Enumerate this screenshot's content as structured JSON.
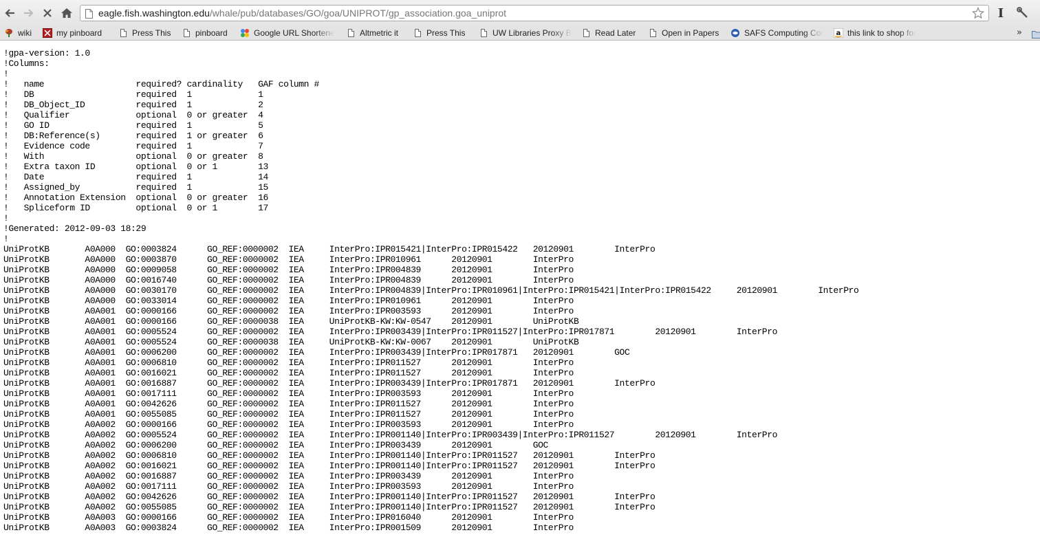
{
  "browser": {
    "url_host": "eagle.fish.washington.edu",
    "url_path": "/whale/pub/databases/GO/goa/UNIPROT/gp_association.goa_uniprot",
    "bookmarks": [
      {
        "label": "wiki",
        "icon": "plant-icon"
      },
      {
        "label": "my pinboard",
        "icon": "pinboard-icon"
      },
      {
        "label": "Press This",
        "icon": "doc-icon"
      },
      {
        "label": "pinboard",
        "icon": "doc-icon"
      },
      {
        "label": "Google URL Shortene",
        "icon": "google-icon"
      },
      {
        "label": "Altmetric it",
        "icon": "doc-icon"
      },
      {
        "label": "Press This",
        "icon": "doc-icon"
      },
      {
        "label": "UW Libraries Proxy B",
        "icon": "doc-icon"
      },
      {
        "label": "Read Later",
        "icon": "doc-icon"
      },
      {
        "label": "Open in Papers",
        "icon": "doc-icon"
      },
      {
        "label": "SAFS Computing Cor",
        "icon": "safs-icon"
      },
      {
        "label": "this link to shop for",
        "icon": "amazon-icon"
      }
    ],
    "overflow_label": "»"
  },
  "header_lines": [
    "!gpa-version: 1.0",
    "!Columns:",
    "!",
    "!   name                  required? cardinality   GAF column #",
    "!   DB                    required  1             1",
    "!   DB_Object_ID          required  1             2",
    "!   Qualifier             optional  0 or greater  4",
    "!   GO ID                 required  1             5",
    "!   DB:Reference(s)       required  1 or greater  6",
    "!   Evidence code         required  1             7",
    "!   With                  optional  0 or greater  8",
    "!   Extra taxon ID        optional  0 or 1        13",
    "!   Date                  required  1             14",
    "!   Assigned_by           required  1             15",
    "!   Annotation Extension  optional  0 or greater  16",
    "!   Spliceform ID         optional  0 or 1        17",
    "!",
    "!Generated: 2012-09-03 18:29",
    "!"
  ],
  "rows": [
    [
      "UniProtKB",
      "A0A000",
      "GO:0003824",
      "GO_REF:0000002",
      "IEA",
      "InterPro:IPR015421|InterPro:IPR015422",
      "20120901",
      "InterPro"
    ],
    [
      "UniProtKB",
      "A0A000",
      "GO:0003870",
      "GO_REF:0000002",
      "IEA",
      "InterPro:IPR010961",
      "20120901",
      "InterPro"
    ],
    [
      "UniProtKB",
      "A0A000",
      "GO:0009058",
      "GO_REF:0000002",
      "IEA",
      "InterPro:IPR004839",
      "20120901",
      "InterPro"
    ],
    [
      "UniProtKB",
      "A0A000",
      "GO:0016740",
      "GO_REF:0000002",
      "IEA",
      "InterPro:IPR004839",
      "20120901",
      "InterPro"
    ],
    [
      "UniProtKB",
      "A0A000",
      "GO:0030170",
      "GO_REF:0000002",
      "IEA",
      "InterPro:IPR004839|InterPro:IPR010961|InterPro:IPR015421|InterPro:IPR015422",
      "20120901",
      "InterPro"
    ],
    [
      "UniProtKB",
      "A0A000",
      "GO:0033014",
      "GO_REF:0000002",
      "IEA",
      "InterPro:IPR010961",
      "20120901",
      "InterPro"
    ],
    [
      "UniProtKB",
      "A0A001",
      "GO:0000166",
      "GO_REF:0000002",
      "IEA",
      "InterPro:IPR003593",
      "20120901",
      "InterPro"
    ],
    [
      "UniProtKB",
      "A0A001",
      "GO:0000166",
      "GO_REF:0000038",
      "IEA",
      "UniProtKB-KW:KW-0547",
      "20120901",
      "UniProtKB"
    ],
    [
      "UniProtKB",
      "A0A001",
      "GO:0005524",
      "GO_REF:0000002",
      "IEA",
      "InterPro:IPR003439|InterPro:IPR011527|InterPro:IPR017871",
      "20120901",
      "InterPro"
    ],
    [
      "UniProtKB",
      "A0A001",
      "GO:0005524",
      "GO_REF:0000038",
      "IEA",
      "UniProtKB-KW:KW-0067",
      "20120901",
      "UniProtKB"
    ],
    [
      "UniProtKB",
      "A0A001",
      "GO:0006200",
      "GO_REF:0000002",
      "IEA",
      "InterPro:IPR003439|InterPro:IPR017871",
      "20120901",
      "GOC"
    ],
    [
      "UniProtKB",
      "A0A001",
      "GO:0006810",
      "GO_REF:0000002",
      "IEA",
      "InterPro:IPR011527",
      "20120901",
      "InterPro"
    ],
    [
      "UniProtKB",
      "A0A001",
      "GO:0016021",
      "GO_REF:0000002",
      "IEA",
      "InterPro:IPR011527",
      "20120901",
      "InterPro"
    ],
    [
      "UniProtKB",
      "A0A001",
      "GO:0016887",
      "GO_REF:0000002",
      "IEA",
      "InterPro:IPR003439|InterPro:IPR017871",
      "20120901",
      "InterPro"
    ],
    [
      "UniProtKB",
      "A0A001",
      "GO:0017111",
      "GO_REF:0000002",
      "IEA",
      "InterPro:IPR003593",
      "20120901",
      "InterPro"
    ],
    [
      "UniProtKB",
      "A0A001",
      "GO:0042626",
      "GO_REF:0000002",
      "IEA",
      "InterPro:IPR011527",
      "20120901",
      "InterPro"
    ],
    [
      "UniProtKB",
      "A0A001",
      "GO:0055085",
      "GO_REF:0000002",
      "IEA",
      "InterPro:IPR011527",
      "20120901",
      "InterPro"
    ],
    [
      "UniProtKB",
      "A0A002",
      "GO:0000166",
      "GO_REF:0000002",
      "IEA",
      "InterPro:IPR003593",
      "20120901",
      "InterPro"
    ],
    [
      "UniProtKB",
      "A0A002",
      "GO:0005524",
      "GO_REF:0000002",
      "IEA",
      "InterPro:IPR001140|InterPro:IPR003439|InterPro:IPR011527",
      "20120901",
      "InterPro"
    ],
    [
      "UniProtKB",
      "A0A002",
      "GO:0006200",
      "GO_REF:0000002",
      "IEA",
      "InterPro:IPR003439",
      "20120901",
      "GOC"
    ],
    [
      "UniProtKB",
      "A0A002",
      "GO:0006810",
      "GO_REF:0000002",
      "IEA",
      "InterPro:IPR001140|InterPro:IPR011527",
      "20120901",
      "InterPro"
    ],
    [
      "UniProtKB",
      "A0A002",
      "GO:0016021",
      "GO_REF:0000002",
      "IEA",
      "InterPro:IPR001140|InterPro:IPR011527",
      "20120901",
      "InterPro"
    ],
    [
      "UniProtKB",
      "A0A002",
      "GO:0016887",
      "GO_REF:0000002",
      "IEA",
      "InterPro:IPR003439",
      "20120901",
      "InterPro"
    ],
    [
      "UniProtKB",
      "A0A002",
      "GO:0017111",
      "GO_REF:0000002",
      "IEA",
      "InterPro:IPR003593",
      "20120901",
      "InterPro"
    ],
    [
      "UniProtKB",
      "A0A002",
      "GO:0042626",
      "GO_REF:0000002",
      "IEA",
      "InterPro:IPR001140|InterPro:IPR011527",
      "20120901",
      "InterPro"
    ],
    [
      "UniProtKB",
      "A0A002",
      "GO:0055085",
      "GO_REF:0000002",
      "IEA",
      "InterPro:IPR001140|InterPro:IPR011527",
      "20120901",
      "InterPro"
    ],
    [
      "UniProtKB",
      "A0A003",
      "GO:0000166",
      "GO_REF:0000002",
      "IEA",
      "InterPro:IPR016040",
      "20120901",
      "InterPro"
    ],
    [
      "UniProtKB",
      "A0A003",
      "GO:0003824",
      "GO_REF:0000002",
      "IEA",
      "InterPro:IPR001509",
      "20120901",
      "InterPro"
    ]
  ]
}
